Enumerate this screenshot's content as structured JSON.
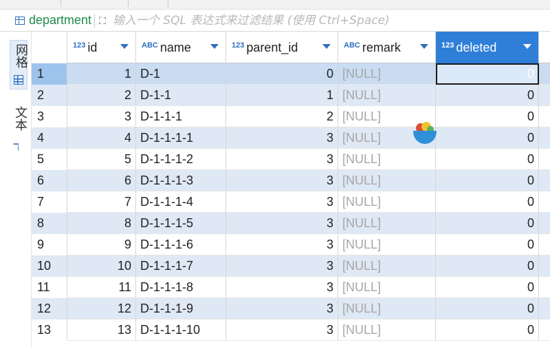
{
  "table": {
    "name": "department",
    "filter_placeholder": "输入一个 SQL 表达式来过滤结果 (使用 Ctrl+Space)"
  },
  "side_tabs": [
    {
      "label": "网格",
      "icon": "grid-icon"
    },
    {
      "label": "文本",
      "icon": "text-icon"
    }
  ],
  "columns": [
    {
      "name": "id",
      "type_badge": "123",
      "icon": "numeric-type-icon"
    },
    {
      "name": "name",
      "type_badge": "ABC",
      "icon": "string-type-icon"
    },
    {
      "name": "parent_id",
      "type_badge": "123",
      "icon": "numeric-type-icon"
    },
    {
      "name": "remark",
      "type_badge": "ABC",
      "icon": "string-type-icon"
    },
    {
      "name": "deleted",
      "type_badge": "123",
      "icon": "numeric-type-icon"
    }
  ],
  "rows": [
    {
      "rownum": "1",
      "id": "1",
      "name": "D-1",
      "parent_id": "0",
      "remark": "[NULL]",
      "deleted": "0"
    },
    {
      "rownum": "2",
      "id": "2",
      "name": "D-1-1",
      "parent_id": "1",
      "remark": "[NULL]",
      "deleted": "0"
    },
    {
      "rownum": "3",
      "id": "3",
      "name": "D-1-1-1",
      "parent_id": "2",
      "remark": "[NULL]",
      "deleted": "0"
    },
    {
      "rownum": "4",
      "id": "4",
      "name": "D-1-1-1-1",
      "parent_id": "3",
      "remark": "[NULL]",
      "deleted": "0"
    },
    {
      "rownum": "5",
      "id": "5",
      "name": "D-1-1-1-2",
      "parent_id": "3",
      "remark": "[NULL]",
      "deleted": "0"
    },
    {
      "rownum": "6",
      "id": "6",
      "name": "D-1-1-1-3",
      "parent_id": "3",
      "remark": "[NULL]",
      "deleted": "0"
    },
    {
      "rownum": "7",
      "id": "7",
      "name": "D-1-1-1-4",
      "parent_id": "3",
      "remark": "[NULL]",
      "deleted": "0"
    },
    {
      "rownum": "8",
      "id": "8",
      "name": "D-1-1-1-5",
      "parent_id": "3",
      "remark": "[NULL]",
      "deleted": "0"
    },
    {
      "rownum": "9",
      "id": "9",
      "name": "D-1-1-1-6",
      "parent_id": "3",
      "remark": "[NULL]",
      "deleted": "0"
    },
    {
      "rownum": "10",
      "id": "10",
      "name": "D-1-1-1-7",
      "parent_id": "3",
      "remark": "[NULL]",
      "deleted": "0"
    },
    {
      "rownum": "11",
      "id": "11",
      "name": "D-1-1-1-8",
      "parent_id": "3",
      "remark": "[NULL]",
      "deleted": "0"
    },
    {
      "rownum": "12",
      "id": "12",
      "name": "D-1-1-1-9",
      "parent_id": "3",
      "remark": "[NULL]",
      "deleted": "0"
    },
    {
      "rownum": "13",
      "id": "13",
      "name": "D-1-1-1-10",
      "parent_id": "3",
      "remark": "[NULL]",
      "deleted": "0"
    }
  ],
  "selection": {
    "row": 1,
    "column": "deleted"
  },
  "colors": {
    "accent": "#2f7fd8",
    "alt_row": "#dfe8f5",
    "null_text": "#a6a6a6",
    "table_name": "#1f8b4c"
  }
}
